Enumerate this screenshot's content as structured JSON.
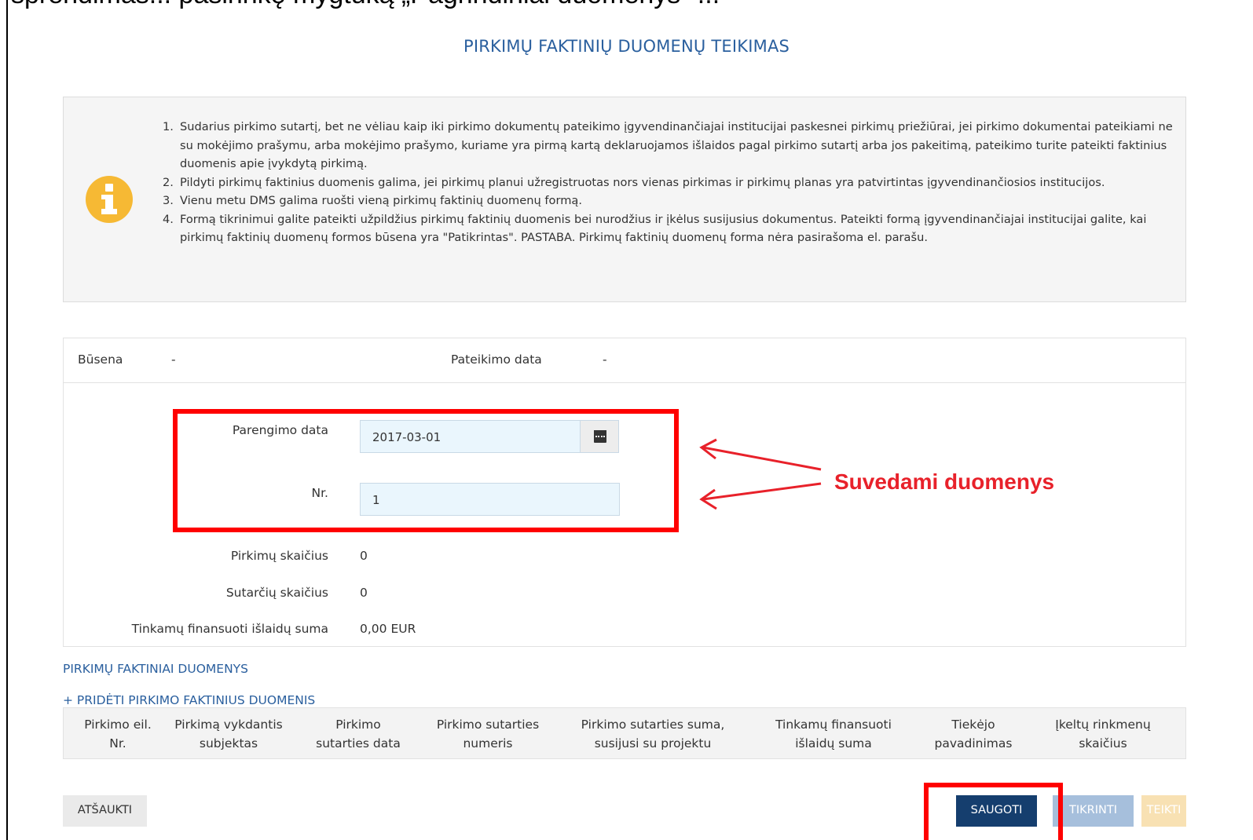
{
  "page": {
    "cut_text": "sprendimas... pasirinkę mygtuką „Pagrindiniai duomenys\" ...",
    "title": "PIRKIMŲ FAKTINIŲ DUOMENŲ TEIKIMAS"
  },
  "info": {
    "items": [
      {
        "num": "1.",
        "text": "Sudarius pirkimo sutartį, bet ne vėliau kaip iki pirkimo dokumentų pateikimo įgyvendinančiajai institucijai paskesnei pirkimų priežiūrai, jei pirkimo dokumentai pateikiami ne su mokėjimo prašymu, arba mokėjimo prašymo, kuriame yra pirmą kartą deklaruojamos išlaidos pagal pirkimo sutartį arba jos pakeitimą, pateikimo turite pateikti faktinius duomenis apie įvykdytą pirkimą."
      },
      {
        "num": "2.",
        "text": "Pildyti pirkimų faktinius duomenis galima, jei pirkimų planui užregistruotas nors vienas pirkimas ir pirkimų planas yra patvirtintas įgyvendinančiosios institucijos."
      },
      {
        "num": "3.",
        "text": "Vienu metu DMS galima ruošti vieną pirkimų faktinių duomenų formą."
      },
      {
        "num": "4.",
        "text": "Formą tikrinimui galite pateikti užpildžius pirkimų faktinių duomenis bei nurodžius ir įkėlus susijusius dokumentus. Pateikti formą įgyvendinančiajai institucijai galite, kai pirkimų faktinių duomenų formos būsena yra \"Patikrintas\". PASTABA. Pirkimų faktinių duomenų forma nėra pasirašoma el. parašu."
      }
    ]
  },
  "status": {
    "state_label": "Būsena",
    "state_value": "-",
    "date_label": "Pateikimo data",
    "date_value": "-"
  },
  "form": {
    "prep_date_label": "Parengimo data",
    "prep_date_value": "2017-03-01",
    "nr_label": "Nr.",
    "nr_value": "1",
    "purchases_label": "Pirkimų skaičius",
    "purchases_value": "0",
    "contracts_label": "Sutarčių skaičius",
    "contracts_value": "0",
    "eligible_label": "Tinkamų finansuoti išlaidų suma",
    "eligible_value": "0,00 EUR"
  },
  "annotation": {
    "text": "Suvedami duomenys"
  },
  "section": {
    "title": "PIRKIMŲ FAKTINIAI DUOMENYS",
    "add_link": "+ PRIDĖTI PIRKIMO FAKTINIUS DUOMENIS"
  },
  "table": {
    "columns": [
      {
        "l1": "Pirkimo eil.",
        "l2": "Nr."
      },
      {
        "l1": "Pirkimą vykdantis",
        "l2": "subjektas"
      },
      {
        "l1": "Pirkimo",
        "l2": "sutarties data"
      },
      {
        "l1": "Pirkimo sutarties",
        "l2": "numeris"
      },
      {
        "l1": "Pirkimo sutarties suma,",
        "l2": "susijusi su projektu"
      },
      {
        "l1": "Tinkamų finansuoti",
        "l2": "išlaidų suma"
      },
      {
        "l1": "Tiekėjo",
        "l2": "pavadinimas"
      },
      {
        "l1": "Įkeltų rinkmenų",
        "l2": "skaičius"
      }
    ]
  },
  "buttons": {
    "cancel": "ATŠAUKTI",
    "save": "SAUGOTI",
    "check": "TIKRINTI",
    "submit": "TEIKTI"
  },
  "colors": {
    "title_blue": "#2a5f9e",
    "save_dark_blue": "#153e6e",
    "annotation_red": "#e8212a",
    "info_yellow": "#f6b934"
  }
}
